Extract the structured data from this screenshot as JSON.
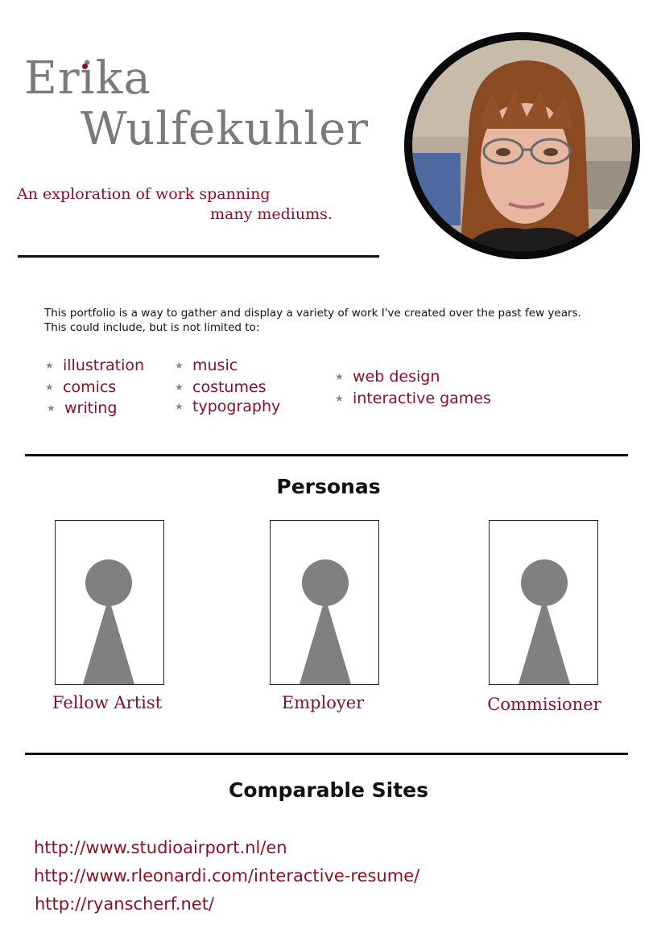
{
  "header": {
    "first_name": "Erika",
    "last_name": "Wulfekuhler",
    "tagline_line1": "An exploration of work spanning",
    "tagline_line2": "many mediums."
  },
  "intro": {
    "line1": "This portfolio is a way to gather and display a variety of work I've created over the past few years.",
    "line2": "This could include, but is not limited to:"
  },
  "mediums": {
    "col1": [
      "illustration",
      "comics",
      "writing"
    ],
    "col2": [
      "music",
      "costumes",
      "typography"
    ],
    "col3": [
      "web design",
      "interactive games"
    ]
  },
  "personas": {
    "title": "Personas",
    "items": [
      "Fellow Artist",
      "Employer",
      "Commisioner"
    ]
  },
  "comparable": {
    "title": "Comparable Sites",
    "links": [
      "http://www.studioairport.nl/en",
      "http://www.rleonardi.com/interactive-resume/",
      "http://ryanscherf.net/"
    ]
  },
  "colors": {
    "accent": "#8b1020",
    "name_gray": "#7a7a7a",
    "persona_gray": "#808080"
  },
  "icons": {
    "bullet": "star-icon",
    "persona": "person-silhouette-icon"
  }
}
